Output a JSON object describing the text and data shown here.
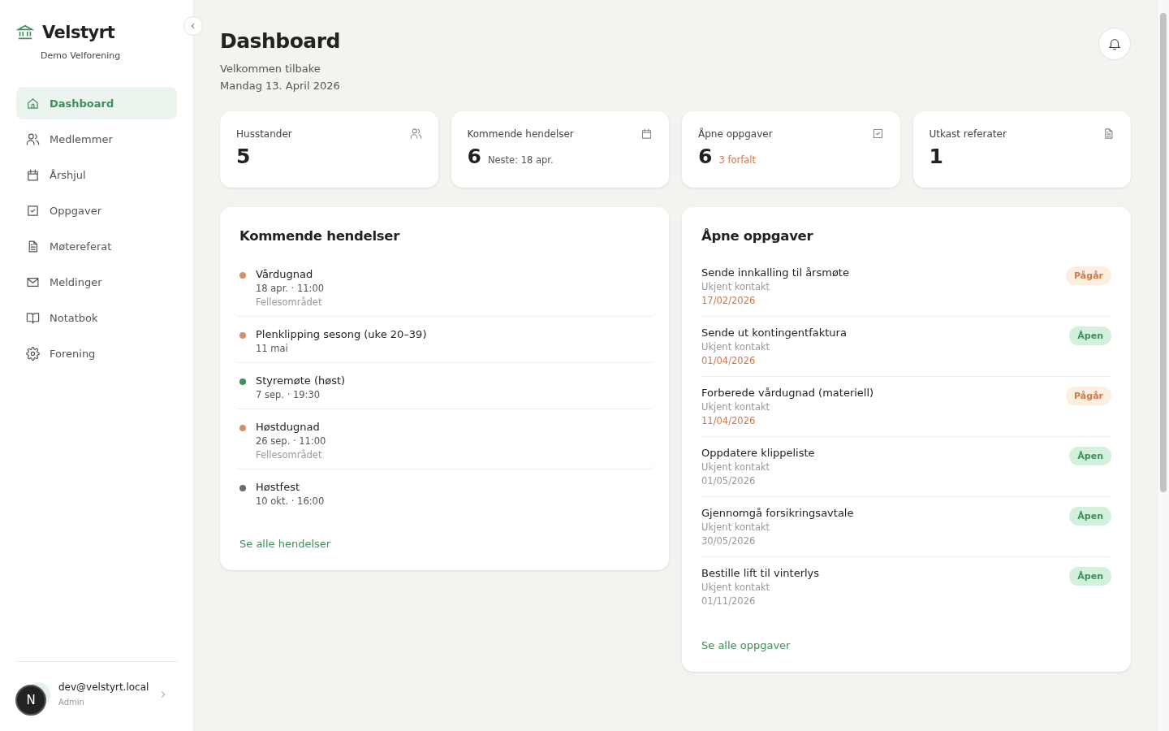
{
  "sidebar": {
    "brand": "Velstyrt",
    "org": "Demo Velforening",
    "items": [
      {
        "label": "Dashboard",
        "selected": true
      },
      {
        "label": "Medlemmer",
        "selected": false
      },
      {
        "label": "Årshjul",
        "selected": false
      },
      {
        "label": "Oppgaver",
        "selected": false
      },
      {
        "label": "Møtereferat",
        "selected": false
      },
      {
        "label": "Meldinger",
        "selected": false
      },
      {
        "label": "Notatbok",
        "selected": false
      },
      {
        "label": "Forening",
        "selected": false
      }
    ],
    "user": {
      "email": "dev@velstyrt.local",
      "role": "Admin"
    },
    "dev_badge": "N"
  },
  "header": {
    "title": "Dashboard",
    "subtitle": "Velkommen tilbake",
    "date": "Mandag 13. April 2026"
  },
  "stats": [
    {
      "label": "Husstander",
      "value": "5"
    },
    {
      "label": "Kommende hendelser",
      "value": "6",
      "note": "Neste: 18 apr.",
      "overdue": false
    },
    {
      "label": "Åpne oppgaver",
      "value": "6",
      "note": "3 forfalt",
      "overdue": true
    },
    {
      "label": "Utkast referater",
      "value": "1"
    }
  ],
  "events": {
    "title": "Kommende hendelser",
    "link": "Se alle hendelser",
    "items": [
      {
        "name": "Vårdugnad",
        "when": "18 apr. · 11:00",
        "place": "Fellesområdet",
        "color": "#d4906a"
      },
      {
        "name": "Plenklipping sesong (uke 20–39)",
        "when": "11 mai",
        "color": "#d4906a"
      },
      {
        "name": "Styremøte (høst)",
        "when": "7 sep. · 19:30",
        "color": "#3e8e5e"
      },
      {
        "name": "Høstdugnad",
        "when": "26 sep. · 11:00",
        "place": "Fellesområdet",
        "color": "#d4906a"
      },
      {
        "name": "Høstfest",
        "when": "10 okt. · 16:00",
        "color": "#6b6b6b"
      }
    ]
  },
  "tasks": {
    "title": "Åpne oppgaver",
    "link": "Se alle oppgaver",
    "items": [
      {
        "name": "Sende innkalling til årsmøte",
        "contact": "Ukjent kontakt",
        "due": "17/02/2026",
        "overdue": true,
        "status": "Pågår",
        "kind": "progress"
      },
      {
        "name": "Sende ut kontingentfaktura",
        "contact": "Ukjent kontakt",
        "due": "01/04/2026",
        "overdue": true,
        "status": "Åpen",
        "kind": "open"
      },
      {
        "name": "Forberede vårdugnad (materiell)",
        "contact": "Ukjent kontakt",
        "due": "11/04/2026",
        "overdue": true,
        "status": "Pågår",
        "kind": "progress"
      },
      {
        "name": "Oppdatere klippeliste",
        "contact": "Ukjent kontakt",
        "due": "01/05/2026",
        "overdue": false,
        "status": "Åpen",
        "kind": "open"
      },
      {
        "name": "Gjennomgå forsikringsavtale",
        "contact": "Ukjent kontakt",
        "due": "30/05/2026",
        "overdue": false,
        "status": "Åpen",
        "kind": "open"
      },
      {
        "name": "Bestille lift til vinterlys",
        "contact": "Ukjent kontakt",
        "due": "01/11/2026",
        "overdue": false,
        "status": "Åpen",
        "kind": "open"
      }
    ]
  }
}
